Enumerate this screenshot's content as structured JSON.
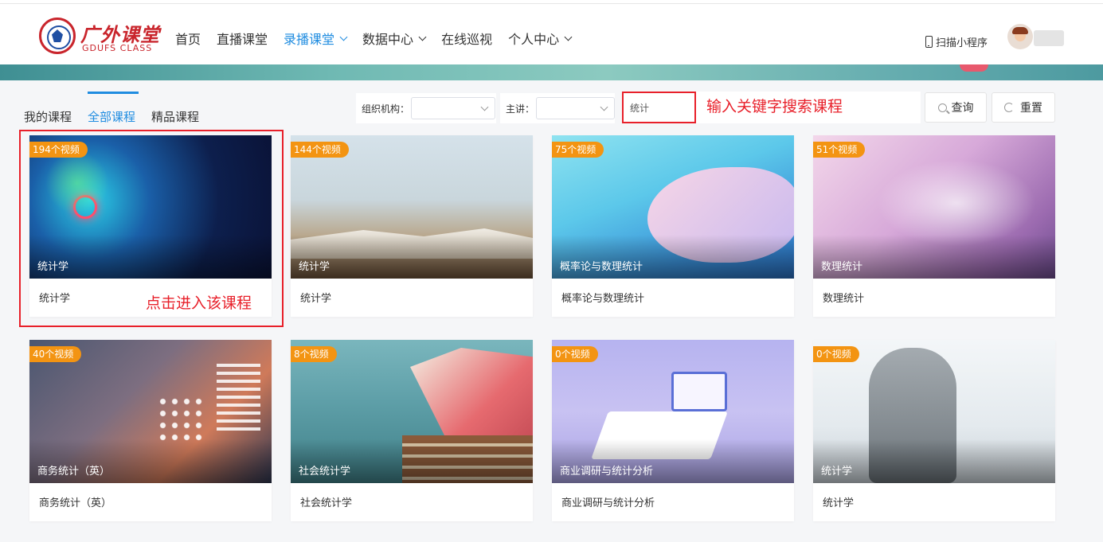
{
  "header": {
    "logo_cn": "广外课堂",
    "logo_en": "GDUFS CLASS",
    "nav": [
      {
        "label": "首页",
        "dropdown": false,
        "active": false
      },
      {
        "label": "直播课堂",
        "dropdown": false,
        "active": false
      },
      {
        "label": "录播课堂",
        "dropdown": true,
        "active": true
      },
      {
        "label": "数据中心",
        "dropdown": true,
        "active": false
      },
      {
        "label": "在线巡视",
        "dropdown": false,
        "active": false
      },
      {
        "label": "个人中心",
        "dropdown": true,
        "active": false
      }
    ],
    "scan_label": "扫描小程序"
  },
  "tabs": [
    {
      "label": "我的课程",
      "active": false
    },
    {
      "label": "全部课程",
      "active": true
    },
    {
      "label": "精品课程",
      "active": false
    }
  ],
  "filters": {
    "org_label": "组织机构：",
    "org_value": "",
    "lecturer_label": "主讲：",
    "lecturer_value": "",
    "search_value": "统计",
    "query_button": "查询",
    "reset_button": "重置"
  },
  "annotations": {
    "search_hint": "输入关键字搜索课程",
    "click_hint": "点击进入该课程"
  },
  "courses": [
    {
      "videos": "194个视频",
      "title": "统计学",
      "name": "统计学"
    },
    {
      "videos": "144个视频",
      "title": "统计学",
      "name": "统计学"
    },
    {
      "videos": "75个视频",
      "title": "概率论与数理统计",
      "name": "概率论与数理统计"
    },
    {
      "videos": "51个视频",
      "title": "数理统计",
      "name": "数理统计"
    },
    {
      "videos": "40个视频",
      "title": "商务统计（英）",
      "name": "商务统计（英）"
    },
    {
      "videos": "8个视频",
      "title": "社会统计学",
      "name": "社会统计学"
    },
    {
      "videos": "0个视频",
      "title": "商业调研与统计分析",
      "name": "商业调研与统计分析"
    },
    {
      "videos": "0个视频",
      "title": "统计学",
      "name": "统计学"
    }
  ],
  "colors": {
    "accent": "#1f8ce0",
    "badge": "#f39412",
    "annotation": "#e8202a",
    "brand": "#c9252c"
  },
  "icons": [
    "logo-emblem",
    "chevron-down-icon",
    "phone-icon",
    "avatar",
    "search-icon",
    "reset-icon"
  ]
}
